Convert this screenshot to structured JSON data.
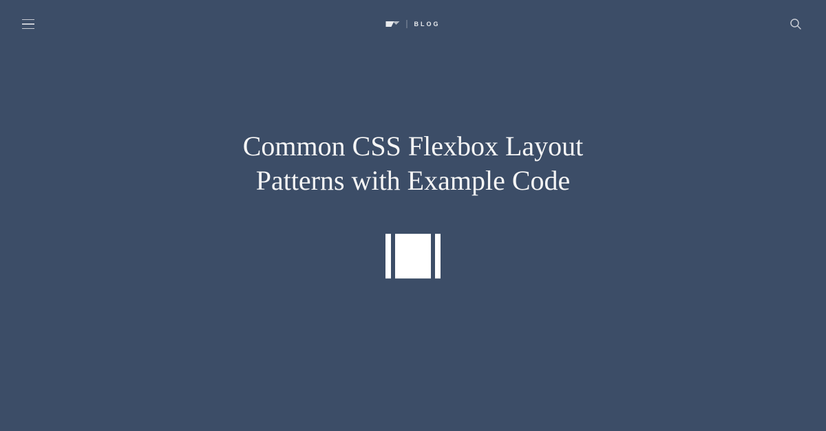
{
  "header": {
    "blog_label": "BLOG"
  },
  "main": {
    "title": "Common CSS Flexbox Layout Patterns with Example Code"
  },
  "colors": {
    "background": "#3c4d67",
    "text": "#ffffff"
  }
}
